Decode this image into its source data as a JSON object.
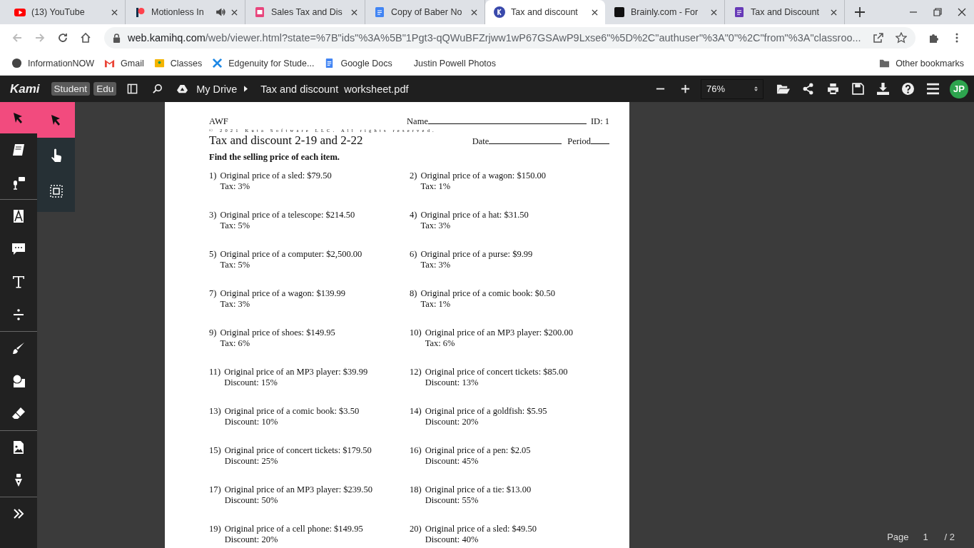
{
  "browser": {
    "tabs": [
      {
        "title": "(13) YouTube",
        "kind": "youtube",
        "selected": false,
        "audio": false
      },
      {
        "title": "Motionless In",
        "kind": "patreon",
        "selected": false,
        "audio": true
      },
      {
        "title": "Sales Tax and Dis",
        "kind": "slides",
        "selected": false,
        "audio": false
      },
      {
        "title": "Copy of Baber No",
        "kind": "docs",
        "selected": false,
        "audio": false
      },
      {
        "title": "Tax and discount",
        "kind": "kami",
        "selected": true,
        "audio": false
      },
      {
        "title": "Brainly.com - For",
        "kind": "brainly",
        "selected": false,
        "audio": false
      },
      {
        "title": "Tax and Discount",
        "kind": "forms",
        "selected": false,
        "audio": false
      }
    ],
    "address": {
      "host": "web.kamihq.com",
      "path": "/web/viewer.html?state=%7B\"ids\"%3A%5B\"1Pgt3-qQWuBFZrjww1wP67GSAwP9Lxse6\"%5D%2C\"authuser\"%3A\"0\"%2C\"from\"%3A\"classroo..."
    },
    "bookmarks": [
      {
        "label": "InformationNOW",
        "kind": "info"
      },
      {
        "label": "Gmail",
        "kind": "gmail"
      },
      {
        "label": "Classes",
        "kind": "classroom"
      },
      {
        "label": "Edgenuity for Stude...",
        "kind": "edgenuity"
      },
      {
        "label": "Google Docs",
        "kind": "docs"
      },
      {
        "label": "Justin Powell Photos",
        "kind": "none"
      }
    ],
    "other_bookmarks": "Other bookmarks"
  },
  "kami": {
    "logo": "Kami",
    "badges": [
      "Student",
      "Edu"
    ],
    "breadcrumb": "My Drive",
    "file": "Tax and discount  worksheet.pdf",
    "zoom": "76%",
    "avatar": "JP",
    "tools": [
      {
        "kind": "select",
        "selected": true
      },
      {
        "kind": "notebook",
        "selected": false
      },
      {
        "kind": "voice",
        "selected": false
      },
      {
        "kind": "markup",
        "selected": false
      },
      {
        "kind": "comment",
        "selected": false
      },
      {
        "kind": "text",
        "selected": false
      },
      {
        "kind": "equation",
        "selected": false
      },
      {
        "kind": "brush",
        "selected": false
      },
      {
        "kind": "shape",
        "selected": false
      },
      {
        "kind": "eraser",
        "selected": false
      },
      {
        "kind": "image",
        "selected": false
      },
      {
        "kind": "signature",
        "selected": false
      },
      {
        "kind": "expand",
        "selected": false
      }
    ],
    "subtools": [
      {
        "kind": "select",
        "selected": true
      },
      {
        "kind": "hand",
        "selected": false
      },
      {
        "kind": "capture",
        "selected": false
      }
    ],
    "page_label": "Page",
    "page": "1",
    "page_total": "/ 2"
  },
  "worksheet": {
    "code": "AWF",
    "name_label": "Name",
    "id": "ID: 1",
    "copyright": "© 2021 Kuta Software LLC. All rights reserved.",
    "title": "Tax and discount 2-19 and 2-22",
    "date_label": "Date",
    "period_label": "Period",
    "instructions": "Find the selling price of each item.",
    "problems": [
      {
        "number": "1)",
        "item": "Original price of a sled: $79.50",
        "rate": "Tax: 3%"
      },
      {
        "number": "2)",
        "item": "Original price of a wagon: $150.00",
        "rate": "Tax: 1%"
      },
      {
        "number": "3)",
        "item": "Original price of a telescope: $214.50",
        "rate": "Tax: 5%"
      },
      {
        "number": "4)",
        "item": "Original price of a hat: $31.50",
        "rate": "Tax: 3%"
      },
      {
        "number": "5)",
        "item": "Original price of a computer: $2,500.00",
        "rate": "Tax: 5%"
      },
      {
        "number": "6)",
        "item": "Original price of a purse: $9.99",
        "rate": "Tax: 3%"
      },
      {
        "number": "7)",
        "item": "Original price of a wagon: $139.99",
        "rate": "Tax: 3%"
      },
      {
        "number": "8)",
        "item": "Original price of a comic book: $0.50",
        "rate": "Tax: 1%"
      },
      {
        "number": "9)",
        "item": "Original price of shoes: $149.95",
        "rate": "Tax: 6%"
      },
      {
        "number": "10)",
        "item": "Original price of an MP3 player: $200.00",
        "rate": "Tax: 6%"
      },
      {
        "number": "11)",
        "item": "Original price of an MP3 player: $39.99",
        "rate": "Discount: 15%"
      },
      {
        "number": "12)",
        "item": "Original price of concert tickets: $85.00",
        "rate": "Discount: 13%"
      },
      {
        "number": "13)",
        "item": "Original price of a comic book: $3.50",
        "rate": "Discount: 10%"
      },
      {
        "number": "14)",
        "item": "Original price of a goldfish: $5.95",
        "rate": "Discount: 20%"
      },
      {
        "number": "15)",
        "item": "Original price of concert tickets: $179.50",
        "rate": "Discount: 25%"
      },
      {
        "number": "16)",
        "item": "Original price of a pen: $2.05",
        "rate": "Discount: 45%"
      },
      {
        "number": "17)",
        "item": "Original price of an MP3 player: $239.50",
        "rate": "Discount: 50%"
      },
      {
        "number": "18)",
        "item": "Original price of a tie: $13.00",
        "rate": "Discount: 55%"
      },
      {
        "number": "19)",
        "item": "Original price of a cell phone: $149.95",
        "rate": "Discount: 20%"
      },
      {
        "number": "20)",
        "item": "Original price of a sled: $49.50",
        "rate": "Discount: 40%"
      }
    ]
  }
}
